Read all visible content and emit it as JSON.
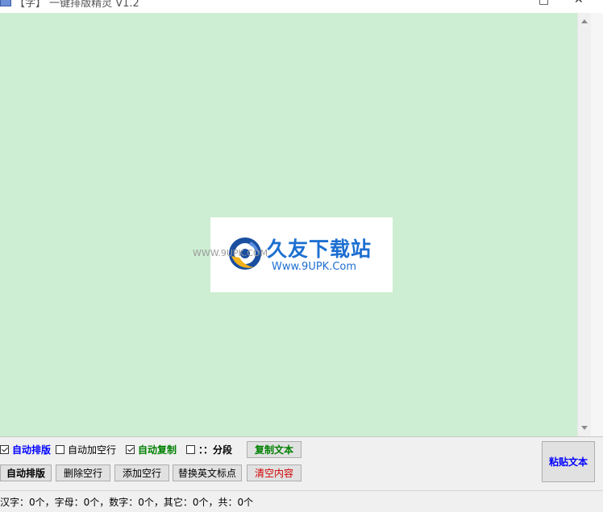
{
  "window": {
    "title": "【字】 一键排版精灵 V1.2",
    "minimize_max_glyph": "□",
    "close_glyph": "✕"
  },
  "editor": {
    "background": "#cdeed2",
    "content": ""
  },
  "watermark": {
    "title": "久友下载站",
    "url": "Www.9UPK.Com",
    "small_url": "WWW.9UPK.COM"
  },
  "options": {
    "auto_format": {
      "label": "自动排版",
      "checked": true
    },
    "auto_add_blank": {
      "label": "自动加空行",
      "checked": false
    },
    "auto_copy": {
      "label": "自动复制",
      "checked": true
    },
    "paragraph": {
      "label": "：：分段",
      "checked": false
    }
  },
  "buttons": {
    "copy_text": "复制文本",
    "auto_format": "自动排版",
    "delete_blank": "删除空行",
    "add_blank": "添加空行",
    "replace_punct": "替换英文标点",
    "clear": "清空内容",
    "paste_text": "粘贴文本"
  },
  "status": {
    "text": "汉字：0个，字母：0个，数字：0个，其它：0个，共：0个"
  }
}
